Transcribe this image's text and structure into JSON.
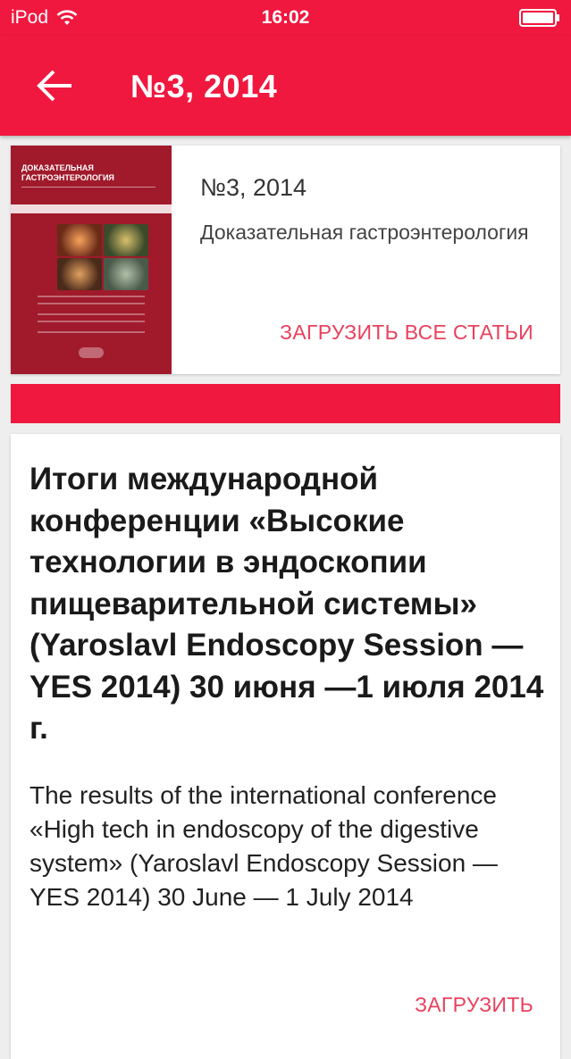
{
  "status_bar": {
    "carrier": "iPod",
    "time": "16:02"
  },
  "app_bar": {
    "title": "№3, 2014",
    "back_icon": "arrow-left-icon"
  },
  "issue": {
    "number": "№3, 2014",
    "journal": "Доказательная гастроэнтерология",
    "download_all_label": "ЗАГРУЗИТЬ ВСЕ СТАТЬИ",
    "cover_title": "ДОКАЗАТЕЛЬНАЯ ГАСТРОЭНТЕРОЛОГИЯ"
  },
  "article": {
    "title_ru": "Итоги международной конференции «Высокие технологии в эндоскопии пищеварительной системы» (Yaroslavl Endoscopy Session — YES 2014) 30 июня —1 июля 2014 г.",
    "title_en": "The results of the international conference «High tech in endoscopy of the digestive system» (Yaroslavl Endoscopy Session — YES 2014) 30 June — 1 July 2014",
    "download_label": "ЗАГРУЗИТЬ"
  },
  "colors": {
    "accent": "#f0183f",
    "link": "#e9415e",
    "cover": "#a01a2b"
  }
}
